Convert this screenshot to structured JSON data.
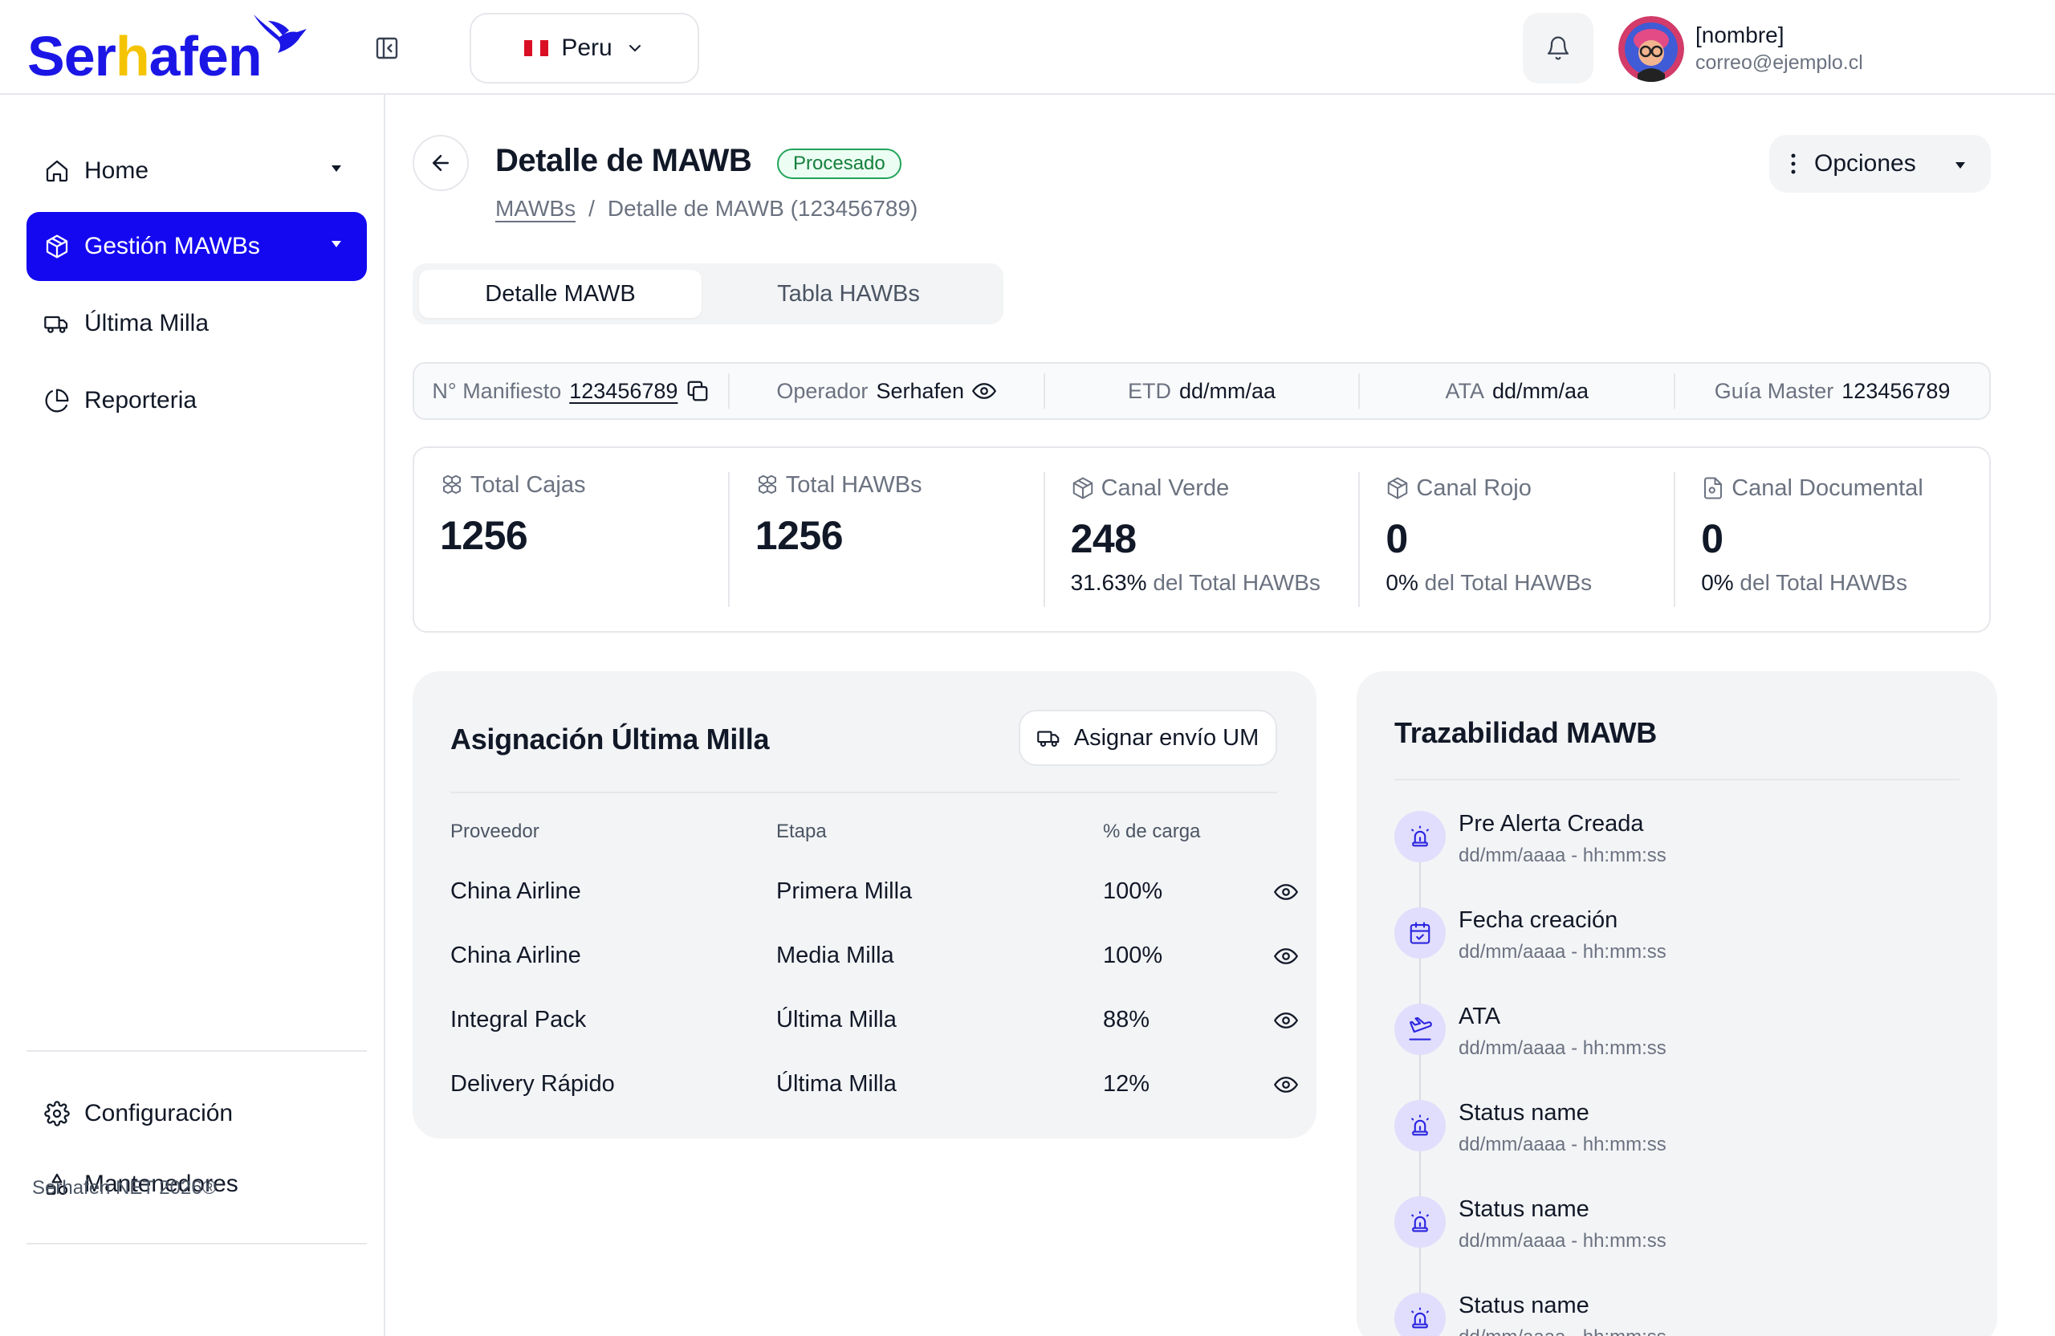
{
  "app": {
    "logo_text_a": "Ser",
    "logo_text_b": "h",
    "logo_text_c": "afen",
    "colors": {
      "brand": "#1408f0",
      "brand_logo": "#1b16e6",
      "accent_yellow": "#f5c400",
      "success": "#22a55a"
    }
  },
  "header": {
    "country": "Peru",
    "user_name": "[nombre]",
    "user_email": "correo@ejemplo.cl",
    "icons": [
      "sidebar-collapse-icon",
      "peru-flag-icon",
      "chevron-down-icon",
      "bell-icon",
      "avatar"
    ]
  },
  "sidebar": {
    "items": [
      {
        "label": "Home",
        "icon": "home-icon"
      },
      {
        "label": "Gestión MAWBs",
        "icon": "box-icon"
      },
      {
        "label": "Última Milla",
        "icon": "truck-icon"
      },
      {
        "label": "Reporteria",
        "icon": "pie-chart-icon"
      }
    ],
    "bottom_items": [
      {
        "label": "Configuración",
        "icon": "gear-icon"
      },
      {
        "label": "Mantenedores",
        "icon": "shapes-icon"
      }
    ],
    "footer": "Serhafen NET 2026®"
  },
  "page": {
    "title": "Detalle de MAWB",
    "status": "Procesado",
    "breadcrumb": {
      "link": "MAWBs",
      "separator": "/",
      "current": "Detalle de MAWB (123456789)"
    },
    "options_label": "Opciones"
  },
  "tabs": [
    "Detalle MAWB",
    "Tabla HAWBs"
  ],
  "info": {
    "manifest_label": "N° Manifiesto",
    "manifest_value": "123456789",
    "operator_label": "Operador",
    "operator_value": "Serhafen",
    "etd_label": "ETD",
    "etd_value": "dd/mm/aa",
    "ata_label": "ATA",
    "ata_value": "dd/mm/aa",
    "master_label": "Guía Master",
    "master_value": "123456789"
  },
  "stats": [
    {
      "label": "Total Cajas",
      "value": "1256",
      "icon": "boxes-icon"
    },
    {
      "label": "Total HAWBs",
      "value": "1256",
      "icon": "boxes-icon"
    },
    {
      "label": "Canal Verde",
      "value": "248",
      "pct": "31.63%",
      "pct_text": " del Total HAWBs",
      "icon": "package-icon"
    },
    {
      "label": "Canal Rojo",
      "value": "0",
      "pct": "0%",
      "pct_text": " del Total HAWBs",
      "icon": "package-icon"
    },
    {
      "label": "Canal Documental",
      "value": "0",
      "pct": "0%",
      "pct_text": " del Total HAWBs",
      "icon": "file-icon"
    }
  ],
  "assignment": {
    "title": "Asignación Última Milla",
    "button": "Asignar envío UM",
    "columns": [
      "Proveedor",
      "Etapa",
      "% de carga"
    ],
    "rows": [
      {
        "provider": "China Airline",
        "stage": "Primera Milla",
        "load": "100%"
      },
      {
        "provider": "China Airline",
        "stage": "Media Milla",
        "load": "100%"
      },
      {
        "provider": "Integral Pack",
        "stage": "Última Milla",
        "load": "88%"
      },
      {
        "provider": "Delivery Rápido",
        "stage": "Última Milla",
        "load": "12%"
      }
    ]
  },
  "traceability": {
    "title": "Trazabilidad MAWB",
    "events": [
      {
        "name": "Pre Alerta Creada",
        "date": "dd/mm/aaaa - hh:mm:ss",
        "icon": "siren-icon"
      },
      {
        "name": "Fecha creación",
        "date": "dd/mm/aaaa - hh:mm:ss",
        "icon": "calendar-check-icon"
      },
      {
        "name": "ATA",
        "date": "dd/mm/aaaa - hh:mm:ss",
        "icon": "plane-landing-icon"
      },
      {
        "name": "Status name",
        "date": "dd/mm/aaaa - hh:mm:ss",
        "icon": "siren-icon"
      },
      {
        "name": "Status name",
        "date": "dd/mm/aaaa - hh:mm:ss",
        "icon": "siren-icon"
      },
      {
        "name": "Status name",
        "date": "dd/mm/aaaa - hh:mm:ss",
        "icon": "siren-icon"
      }
    ]
  }
}
